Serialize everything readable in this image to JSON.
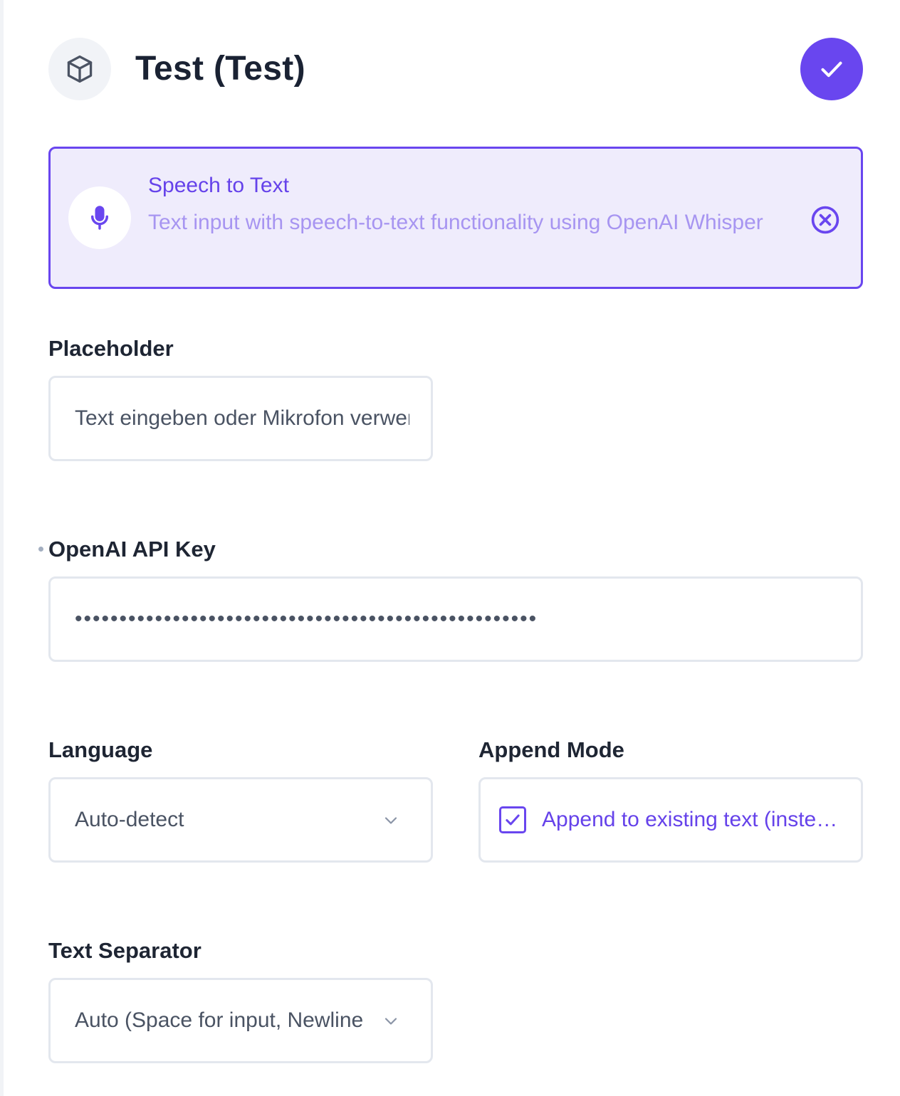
{
  "header": {
    "title": "Test (Test)",
    "icon": "cube-icon",
    "confirm_icon": "check-icon"
  },
  "component": {
    "name": "Speech to Text",
    "description": "Text input with speech-to-text functionality using OpenAI Whisper",
    "icon": "microphone-icon",
    "remove_icon": "close-circle-icon"
  },
  "fields": {
    "placeholder": {
      "label": "Placeholder",
      "value": "Text eingeben oder Mikrofon verwenden..."
    },
    "api_key": {
      "label": "OpenAI API Key",
      "value": "••••••••••••••••••••••••••••••••••••••••••••••••••••"
    },
    "language": {
      "label": "Language",
      "value": "Auto-detect"
    },
    "append_mode": {
      "label": "Append Mode",
      "checkbox_label": "Append to existing text (inste…",
      "checked": true
    },
    "separator": {
      "label": "Text Separator",
      "value": "Auto (Space for input, Newline for textarea)"
    }
  },
  "colors": {
    "accent": "#6946ef",
    "accent_light": "#efecfc",
    "border": "#e3e7ee"
  }
}
